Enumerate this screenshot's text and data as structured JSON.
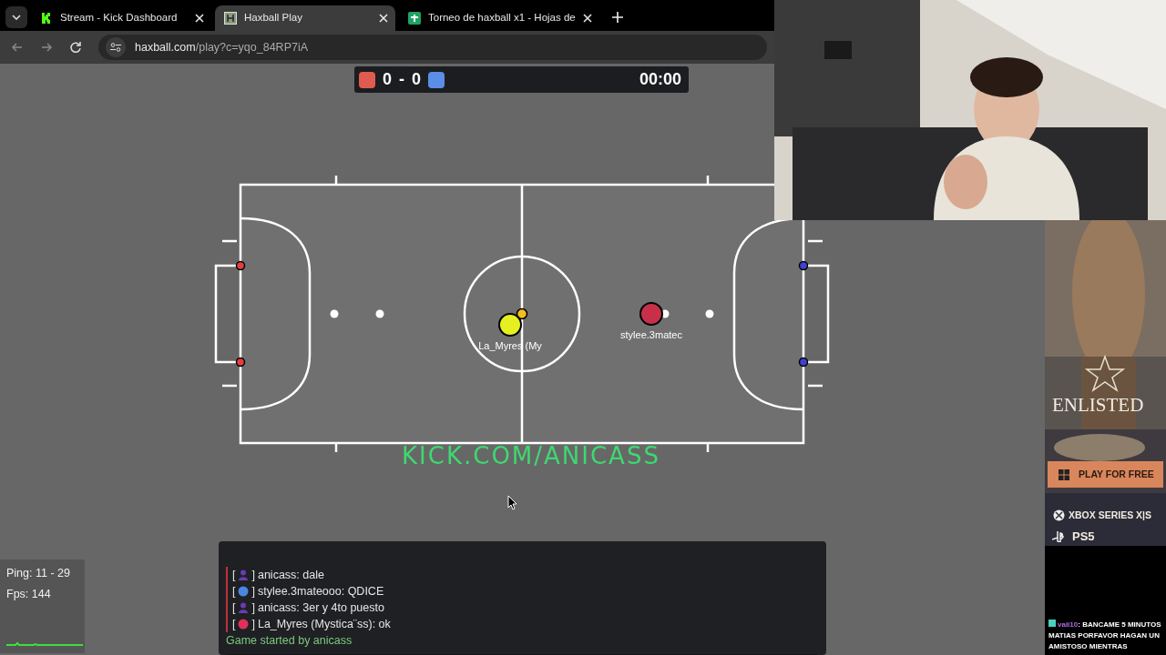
{
  "tabs": [
    {
      "title": "Stream - Kick Dashboard",
      "selected": false
    },
    {
      "title": "Haxball Play",
      "selected": true
    },
    {
      "title": "Torneo de haxball x1 - Hojas de",
      "selected": false
    }
  ],
  "address": {
    "host": "haxball.com",
    "path": "/play?c=yqo_84RP7iA"
  },
  "scoreboard": {
    "red_score": "0",
    "separator": "-",
    "blue_score": "0",
    "time": "00:00"
  },
  "players": [
    {
      "name": "La_Myres (My",
      "color": "#e6f020"
    },
    {
      "name": "stylee.3matec",
      "color": "#c8304a"
    }
  ],
  "overlay_text": "KICK.COM/ANICASS",
  "chat": {
    "bracket_open": "[",
    "bracket_close": "]",
    "messages": [
      {
        "kind": "figure",
        "color": "#6a3bb0",
        "text": "anicass: dale"
      },
      {
        "kind": "disc",
        "color": "#4a86e0",
        "text": "stylee.3mateooo: QDICE"
      },
      {
        "kind": "figure",
        "color": "#6a3bb0",
        "text": "anicass: 3er y 4to puesto"
      },
      {
        "kind": "disc",
        "color": "#e0305a",
        "text": "La_Myres (Mystica¨ss): ok"
      }
    ],
    "notice": "Game started by anicass"
  },
  "stats": {
    "ping": "Ping: 11 - 29",
    "fps": "Fps: 144"
  },
  "ad": {
    "title": "ENLISTED",
    "button": "PLAY FOR FREE",
    "platforms": [
      "XBOX SERIES X|S",
      "PS5"
    ]
  },
  "stream_chat": {
    "user": "vaii10",
    "message": ": BANCAME 5 MINUTOS MATIAS PORFAVOR HAGAN UN AMISTOSO MIENTRAS"
  }
}
